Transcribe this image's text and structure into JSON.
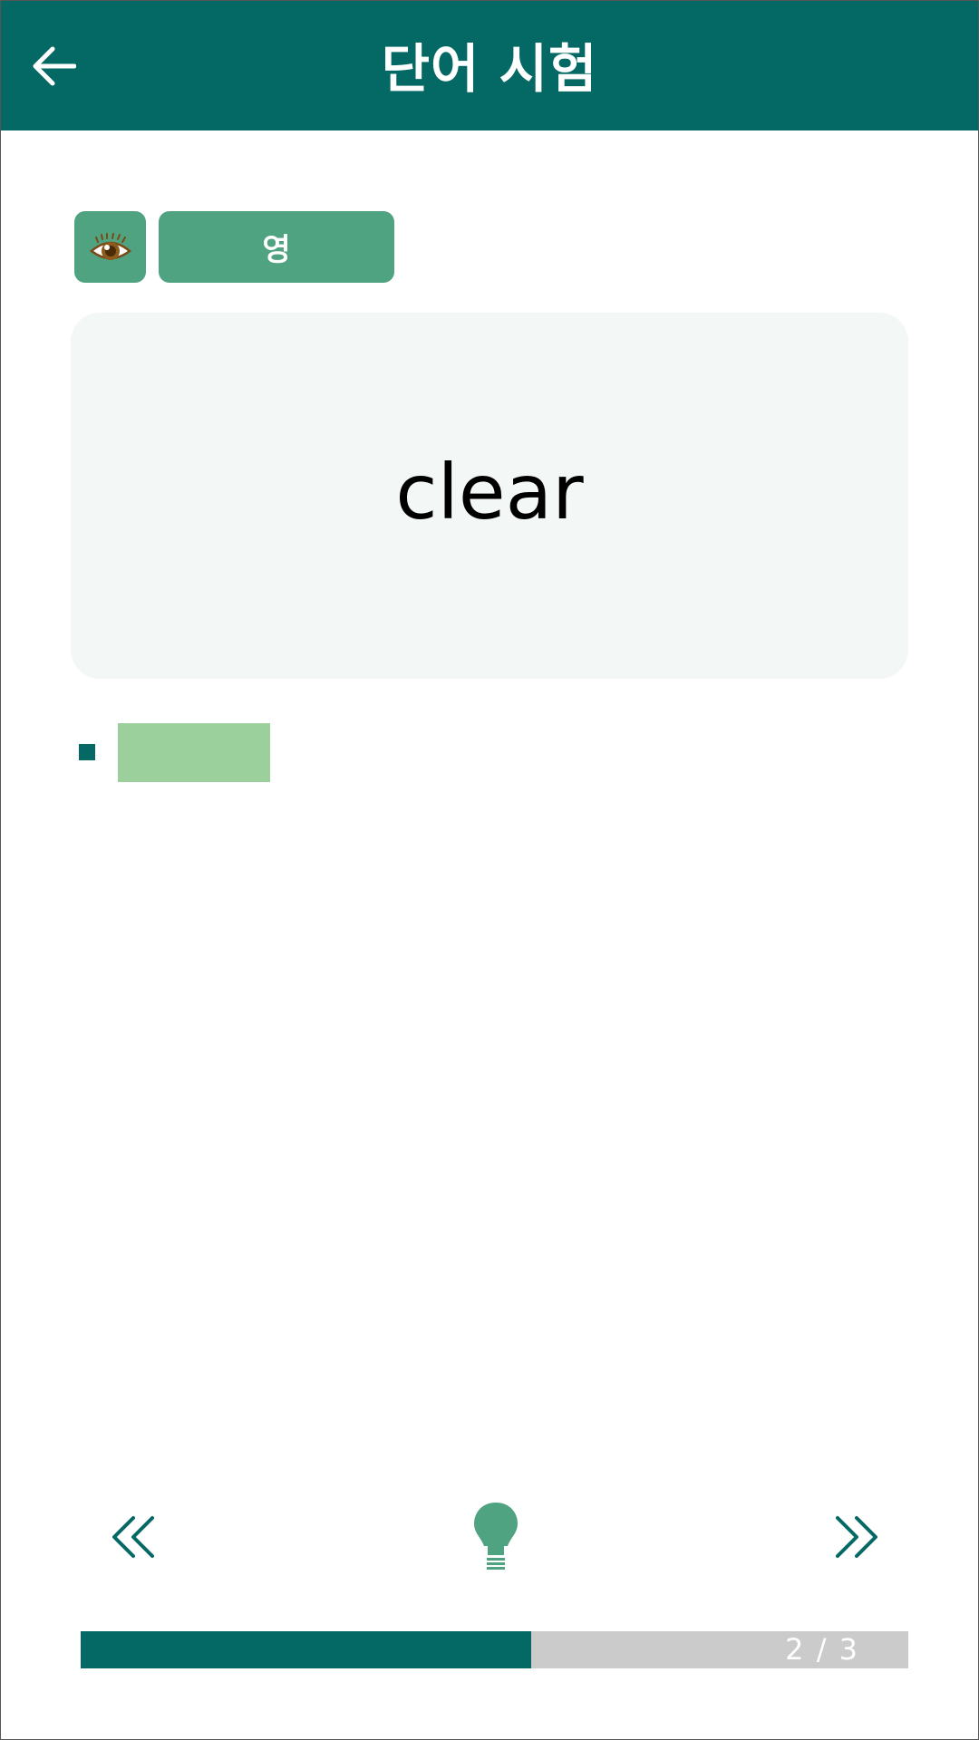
{
  "header": {
    "title": "단어 시험",
    "back_icon": "arrow-left-icon"
  },
  "controls": {
    "eye_icon": "eye-icon",
    "language_label": "영"
  },
  "card": {
    "word": "clear"
  },
  "answer": {
    "hidden": true
  },
  "navigation": {
    "prev_icon": "double-chevron-left-icon",
    "hint_icon": "lightbulb-icon",
    "next_icon": "double-chevron-right-icon"
  },
  "progress": {
    "current": 2,
    "total": 3,
    "text": "2 / 3",
    "fraction": 0.5443
  },
  "colors": {
    "primary": "#046964",
    "accent": "#4fa381",
    "answer_box": "#9bcf9c",
    "card_bg": "#f3f7f6",
    "progress_track": "#cbcbcb"
  }
}
